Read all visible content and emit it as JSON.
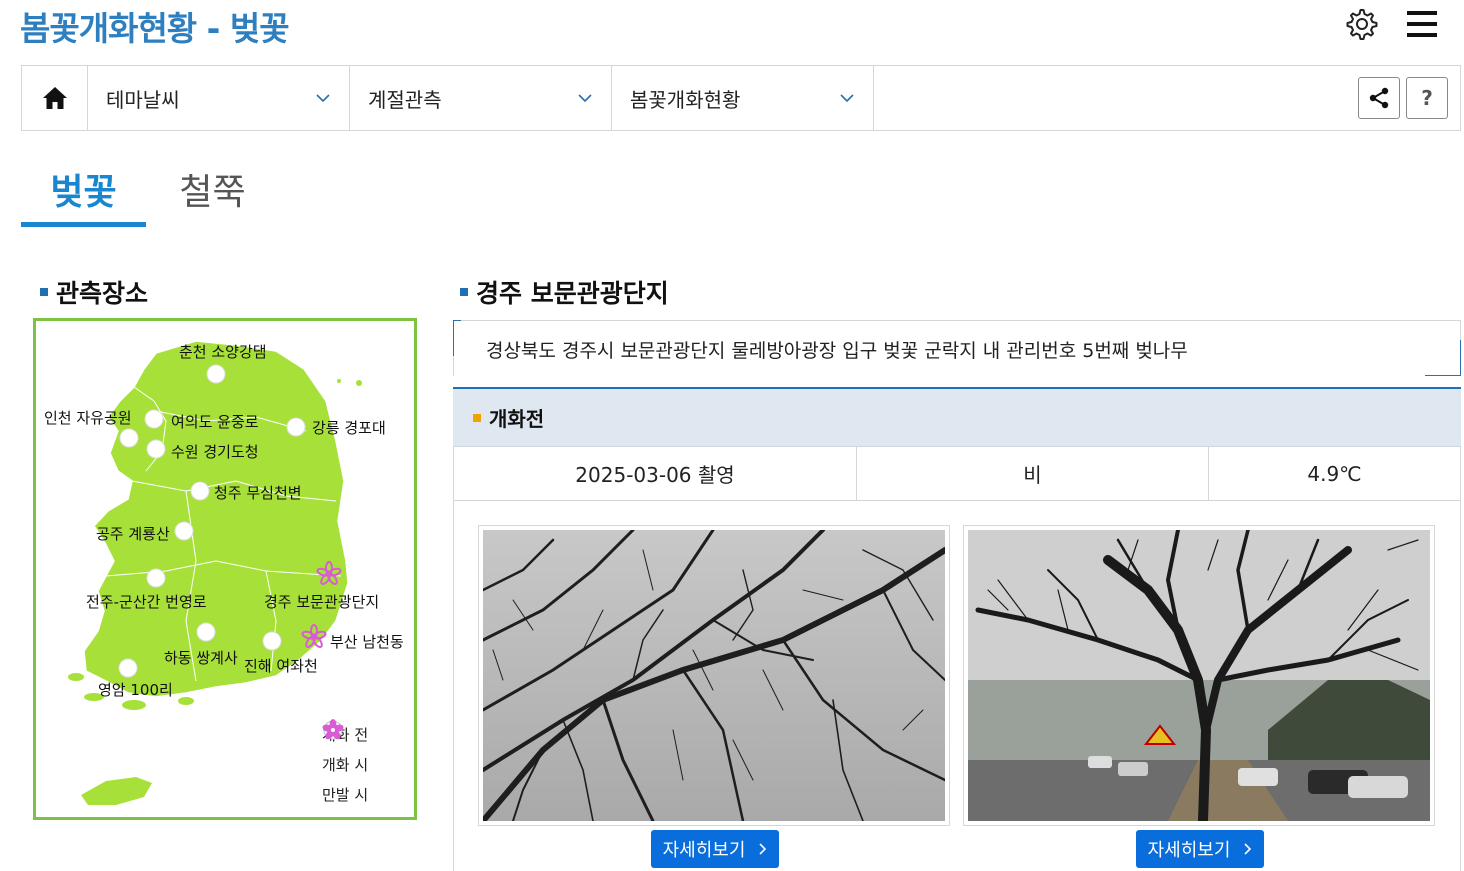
{
  "header": {
    "title": "봄꽃개화현황 - 벚꽃"
  },
  "nav": {
    "items": [
      {
        "label": "테마날씨"
      },
      {
        "label": "계절관측"
      },
      {
        "label": "봄꽃개화현황"
      }
    ],
    "help_label": "?"
  },
  "tabs": [
    {
      "label": "벚꽃",
      "active": true
    },
    {
      "label": "철쭉",
      "active": false
    }
  ],
  "left_section": {
    "title": "관측장소",
    "locations": [
      {
        "name": "춘천 소양강댐",
        "status": "개화 전"
      },
      {
        "name": "인천 자유공원",
        "status": "개화 전"
      },
      {
        "name": "여의도 윤중로",
        "status": "개화 전"
      },
      {
        "name": "수원 경기도청",
        "status": "개화 전"
      },
      {
        "name": "강릉 경포대",
        "status": "개화 전"
      },
      {
        "name": "청주 무심천변",
        "status": "개화 전"
      },
      {
        "name": "공주 계룡산",
        "status": "개화 전"
      },
      {
        "name": "전주-군산간 번영로",
        "status": "개화 전"
      },
      {
        "name": "경주 보문관광단지",
        "status": "개화 시"
      },
      {
        "name": "부산 남천동",
        "status": "개화 시"
      },
      {
        "name": "하동 쌍계사",
        "status": "개화 전"
      },
      {
        "name": "진해 여좌천",
        "status": "개화 전"
      },
      {
        "name": "영암 100리",
        "status": "개화 전"
      }
    ],
    "legend": [
      {
        "label": "개화 전",
        "icon": "white-circle-icon"
      },
      {
        "label": "개화 시",
        "icon": "pink-outline-flower-icon"
      },
      {
        "label": "만발 시",
        "icon": "pink-filled-flower-icon"
      }
    ]
  },
  "right_section": {
    "title": "경주 보문관광단지",
    "description": "경상북도 경주시 보문관광단지 물레방아광장 입구 벚꽃 군락지 내 관리번호 5번째 벚나무",
    "status": "개화전",
    "date": "2025-03-06 촬영",
    "weather": "비",
    "temperature": "4.9℃",
    "photos": [
      {
        "caption": "자세히보기"
      },
      {
        "caption": "자세히보기"
      }
    ]
  },
  "colors": {
    "title_blue": "#2e7fc0",
    "tab_active": "#1a86d0",
    "map_green": "#a8e03a",
    "map_border": "#7ec242",
    "button_blue": "#0a6ddc",
    "status_bg": "#dfe7f1",
    "flower_pink": "#d95bd6"
  }
}
